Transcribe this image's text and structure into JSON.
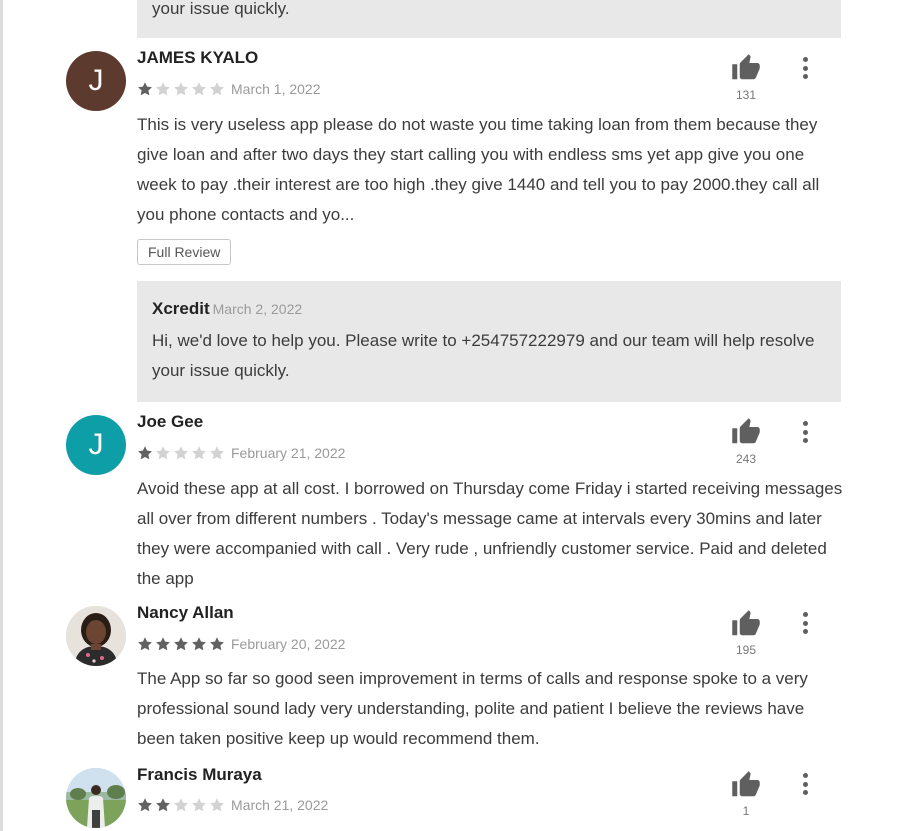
{
  "first_reply": {
    "text_tail": "your issue quickly."
  },
  "reviews": [
    {
      "author": "JAMES KYALO",
      "avatar_letter": "J",
      "avatar_color": "#5d3a2e",
      "rating": 1,
      "date": "March 1, 2022",
      "text": "This is very useless app please do not waste you time taking loan from them because they give loan and after two days they start calling you with endless sms yet app give you one week to pay .their interest are too high .they give 1440 and tell you to pay 2000.they call all you phone contacts and yo...",
      "likes": "131",
      "full_review_label": "Full Review",
      "reply": {
        "developer": "Xcredit",
        "date": "March 2, 2022",
        "text": "Hi, we'd love to help you. Please write to +254757222979 and our team will help resolve your issue quickly."
      }
    },
    {
      "author": "Joe Gee",
      "avatar_letter": "J",
      "avatar_color": "#0e9ea8",
      "rating": 1,
      "date": "February 21, 2022",
      "text": "Avoid these app at all cost. I borrowed on Thursday come Friday i started receiving mes­sages all over from different numbers . Today's message came at intervals every 30mins and later they were accompanied with call . Very rude , unfriendly customer service. Paid and deleted the app",
      "likes": "243"
    },
    {
      "author": "Nancy Allan",
      "avatar_photo": "woman-portrait",
      "rating": 5,
      "date": "February 20, 2022",
      "text": "The App so far so good seen improvement in terms of calls and response spoke to a very professional sound lady very understanding, polite and patient I believe the reviews have been taken positive keep up would recommend them.",
      "likes": "195"
    },
    {
      "author": "Francis Muraya",
      "avatar_photo": "man-outdoors-portrait",
      "rating": 2,
      "date": "March 21, 2022",
      "likes": "1"
    }
  ],
  "colors": {
    "star_filled": "#616161",
    "star_empty": "#d2d2d2",
    "reply_background": "#e8e8e8"
  },
  "icons": {
    "like": "thumbs-up-icon",
    "menu": "more-vert-icon"
  }
}
